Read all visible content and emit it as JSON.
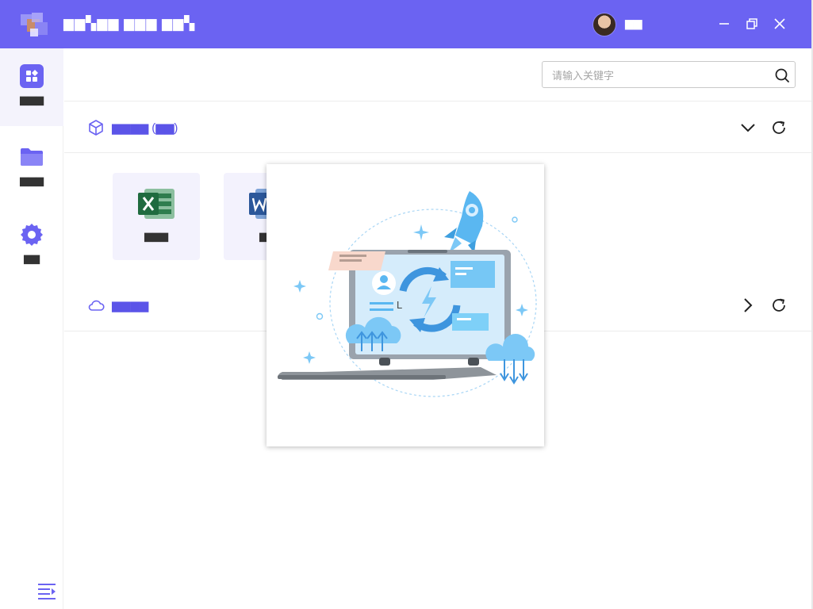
{
  "app": {
    "title": "▆▆▚▆▆ ▆▆▆ ▆▆▚",
    "user_name": "▆▆",
    "brand_color": "#6b63f2",
    "accent_color": "#5b54e8"
  },
  "window_controls": {
    "minimize_icon": "minimize-icon",
    "restore_icon": "restore-icon",
    "close_icon": "close-icon"
  },
  "sidebar": {
    "items": [
      {
        "label": "▆▆▆",
        "icon": "apps-grid-icon",
        "active": true
      },
      {
        "label": "▆▆▆",
        "icon": "folder-icon",
        "active": false
      },
      {
        "label": "▆▆",
        "icon": "gear-icon",
        "active": false
      }
    ],
    "menu_icon": "menu-expand-icon"
  },
  "search": {
    "placeholder": "请输入关键字",
    "value": ""
  },
  "sections": [
    {
      "title": "▆▆▆▆ (▆▆)",
      "icon": "cube-icon",
      "toggle_icon": "chevron-down-icon",
      "refresh_icon": "refresh-icon",
      "expanded": true,
      "tiles": [
        {
          "label": "▆▆▆",
          "icon": "excel-icon"
        },
        {
          "label": "▆▆",
          "icon": "word-icon"
        }
      ]
    },
    {
      "title": "▆▆▆▆",
      "icon": "cloud-icon",
      "toggle_icon": "chevron-right-icon",
      "refresh_icon": "refresh-icon",
      "expanded": false
    }
  ],
  "loading": {
    "text": "L",
    "illustration": "laptop-sync-rocket-illustration"
  }
}
